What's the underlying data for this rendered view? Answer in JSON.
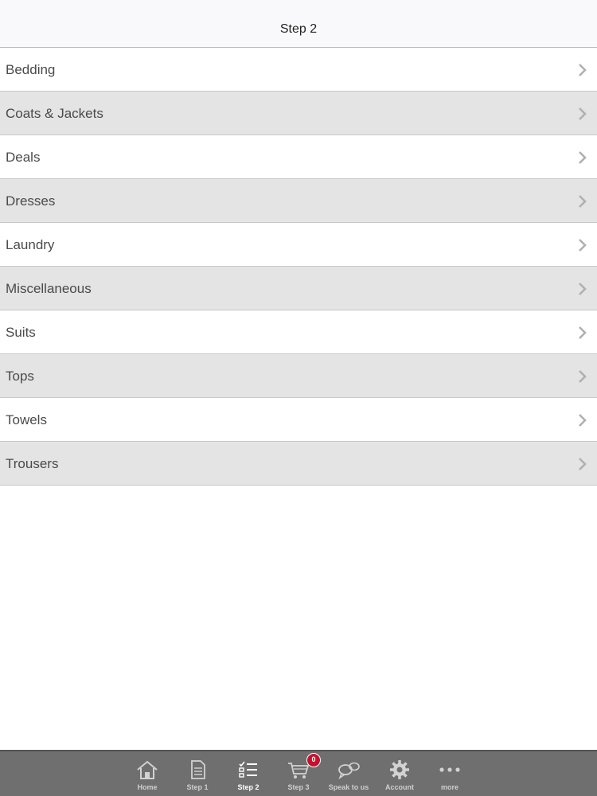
{
  "navbar": {
    "title": "Step 2"
  },
  "categories": [
    {
      "label": "Bedding"
    },
    {
      "label": "Coats & Jackets"
    },
    {
      "label": "Deals"
    },
    {
      "label": "Dresses"
    },
    {
      "label": "Laundry"
    },
    {
      "label": "Miscellaneous"
    },
    {
      "label": "Suits"
    },
    {
      "label": "Tops"
    },
    {
      "label": "Towels"
    },
    {
      "label": "Trousers"
    }
  ],
  "tabbar": {
    "active_tab": "Step 2",
    "cart_badge": "0",
    "tabs": [
      {
        "label": "Home",
        "icon": "home-icon"
      },
      {
        "label": "Step 1",
        "icon": "document-icon"
      },
      {
        "label": "Step 2",
        "icon": "checklist-icon"
      },
      {
        "label": "Step 3",
        "icon": "cart-icon"
      },
      {
        "label": "Speak to us",
        "icon": "speech-bubbles-icon"
      },
      {
        "label": "Account",
        "icon": "gear-icon"
      },
      {
        "label": "more",
        "icon": "more-dots-icon"
      }
    ]
  },
  "colors": {
    "navbar_bg": "#f9f8fb",
    "row_alt_bg": "#e4e4e4",
    "tabbar_bg": "#6f6f6f",
    "badge_bg": "#c8102e"
  }
}
